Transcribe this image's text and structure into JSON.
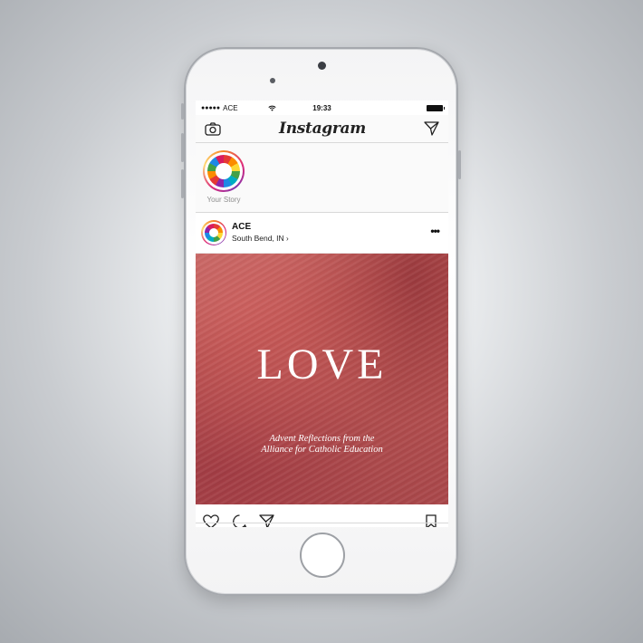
{
  "status_bar": {
    "carrier": "ACE",
    "time": "19:33"
  },
  "app": {
    "title": "Instagram"
  },
  "stories": {
    "your_story_label": "Your Story"
  },
  "post": {
    "username": "ACE",
    "location": "South Bend, IN",
    "image_title": "LOVE",
    "image_subtitle_line1": "Advent Reflections from the",
    "image_subtitle_line2": "Alliance for Catholic Education"
  },
  "colors": {
    "post_image_bg": "#b54f4f",
    "story_ring_start": "#f58529",
    "story_ring_end": "#dd2a7b"
  }
}
